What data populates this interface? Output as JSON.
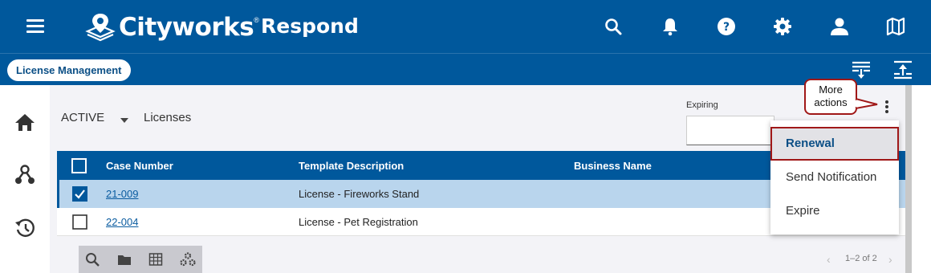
{
  "header": {
    "brand": "Cityworks",
    "trademark": "®",
    "app_title": "Respond",
    "icons": [
      "menu-icon",
      "search-icon",
      "bell-icon",
      "help-icon",
      "gear-icon",
      "user-icon",
      "map-icon"
    ]
  },
  "subheader": {
    "module_label": "License Management",
    "icons": [
      "filter-down-icon",
      "upload-icon"
    ]
  },
  "sidebar": {
    "icons": [
      "home-icon",
      "workflow-icon",
      "history-icon"
    ]
  },
  "view": {
    "status": "ACTIVE",
    "title": "Licenses"
  },
  "expiring_filter": {
    "label": "Expiring",
    "value": ""
  },
  "callout": {
    "line1": "More",
    "line2": "actions"
  },
  "grid": {
    "columns": [
      "Case Number",
      "Template Description",
      "Business Name"
    ],
    "rows": [
      {
        "selected": true,
        "case_number": "21-009",
        "template": "License - Fireworks Stand",
        "business": ""
      },
      {
        "selected": false,
        "case_number": "22-004",
        "template": "License - Pet Registration",
        "business": ""
      }
    ]
  },
  "more_actions_menu": {
    "items": [
      "Renewal",
      "Send Notification",
      "Expire"
    ],
    "highlighted": "Renewal"
  },
  "footer_toolbar": {
    "icons": [
      "search-icon",
      "folder-icon",
      "table-icon",
      "settings-group-icon"
    ]
  },
  "pager": {
    "text": "1–2 of 2"
  },
  "colors": {
    "brand_blue": "#00589c",
    "selected_row": "#b9d5ed",
    "callout_border": "#a01818"
  }
}
